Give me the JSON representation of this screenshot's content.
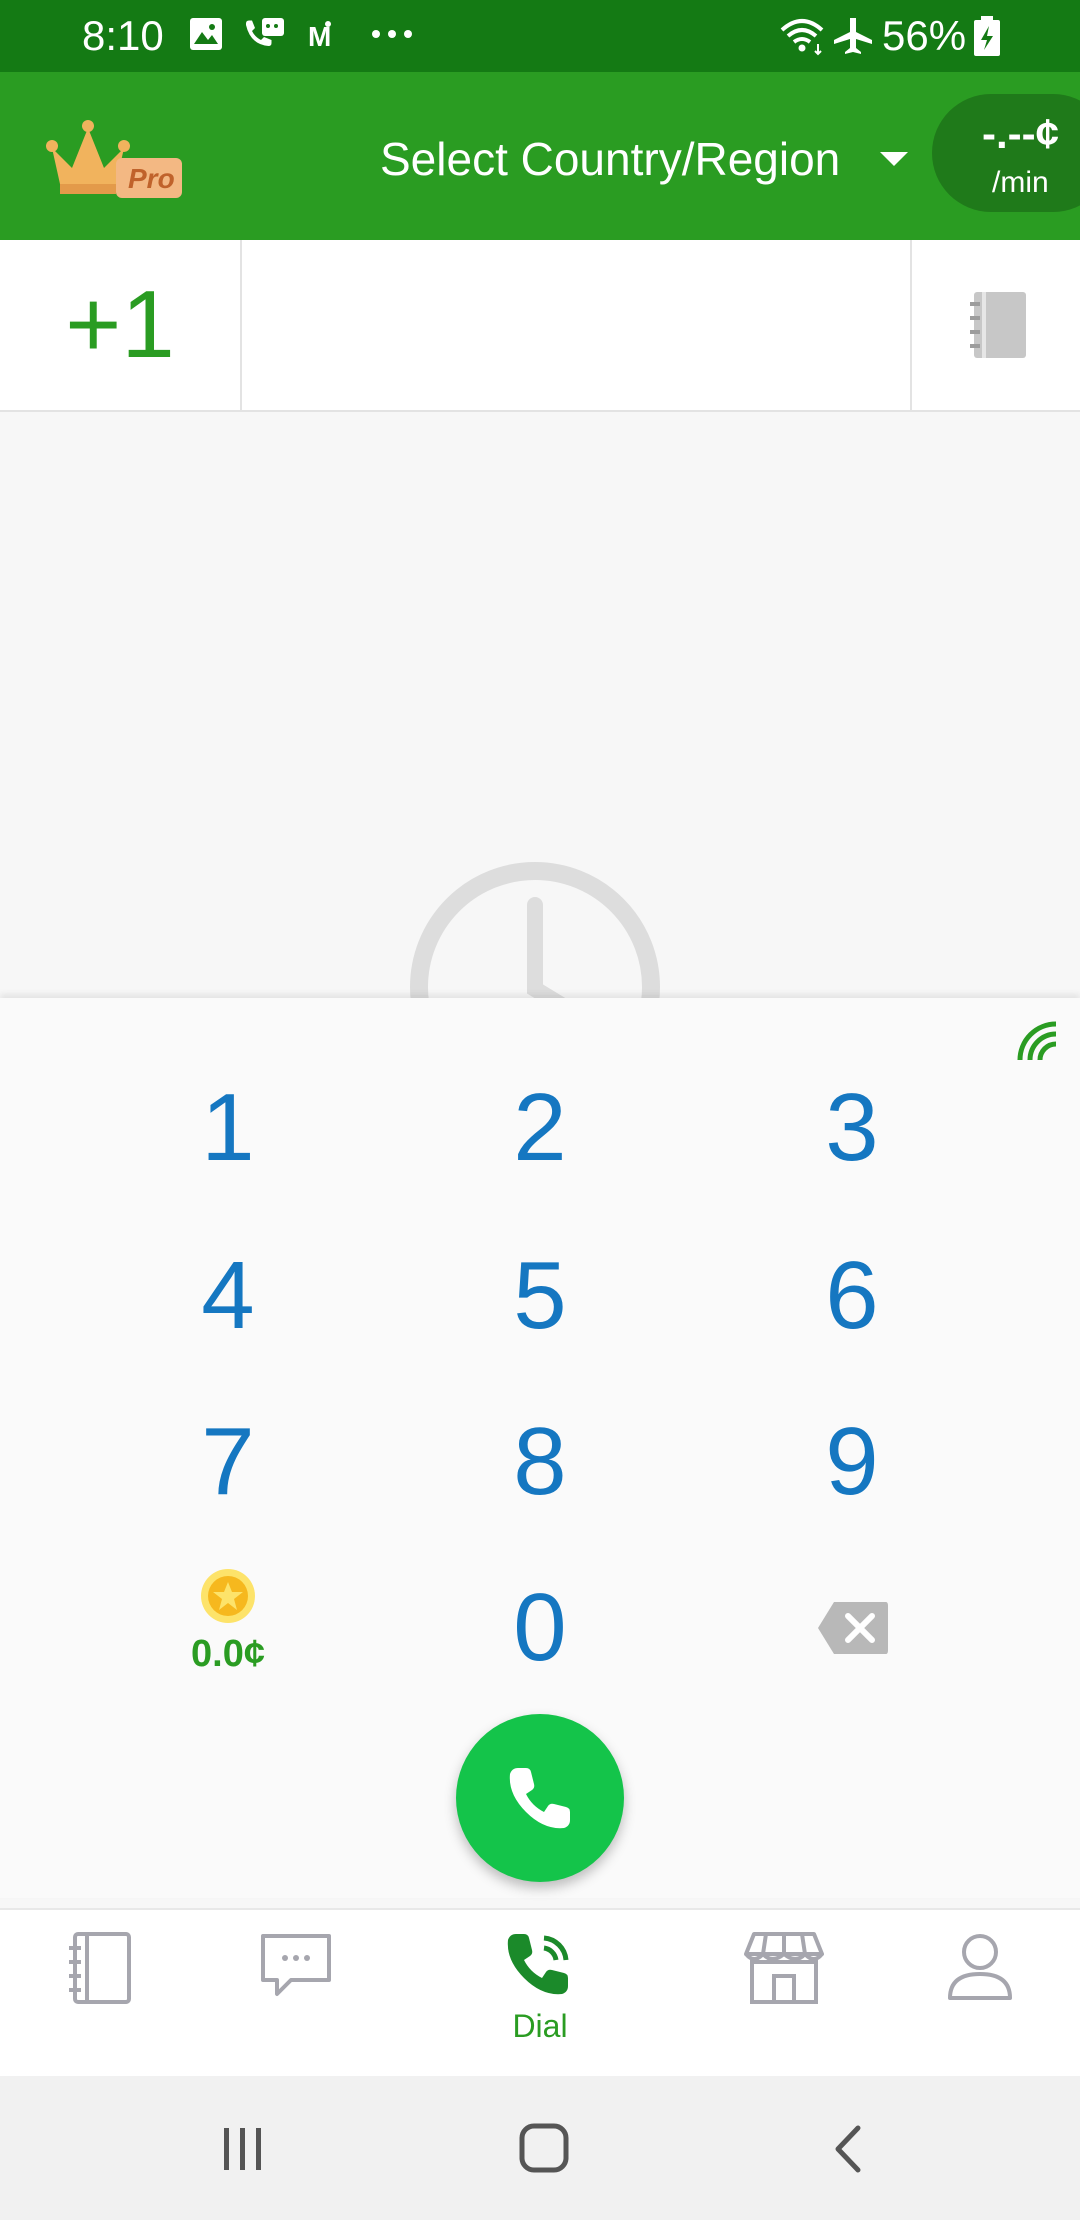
{
  "status_bar": {
    "time": "8:10",
    "battery_percent": "56%",
    "icons": [
      "image-icon",
      "chat-app-icon",
      "gmail-icon",
      "more-dots-icon",
      "wifi-icon",
      "airplane-icon",
      "battery-icon"
    ]
  },
  "app_bar": {
    "logo_badge": "Pro",
    "country_selector_label": "Select Country/Region",
    "rate_value": "-.--¢",
    "rate_unit": "/min"
  },
  "number_entry": {
    "country_code": "+1",
    "value": "",
    "placeholder": ""
  },
  "keypad": {
    "keys": [
      "1",
      "2",
      "3",
      "4",
      "5",
      "6",
      "7",
      "8",
      "9",
      "0"
    ],
    "balance": "0.0¢"
  },
  "bottom_nav": {
    "items": [
      {
        "id": "contacts",
        "label": ""
      },
      {
        "id": "messages",
        "label": ""
      },
      {
        "id": "dial",
        "label": "Dial"
      },
      {
        "id": "store",
        "label": ""
      },
      {
        "id": "profile",
        "label": ""
      }
    ]
  },
  "colors": {
    "status_bar": "#147a14",
    "app_bar": "#2a9c22",
    "key_digit": "#1577c1",
    "call_button": "#14c44a",
    "accent_green": "#2a9c22"
  }
}
